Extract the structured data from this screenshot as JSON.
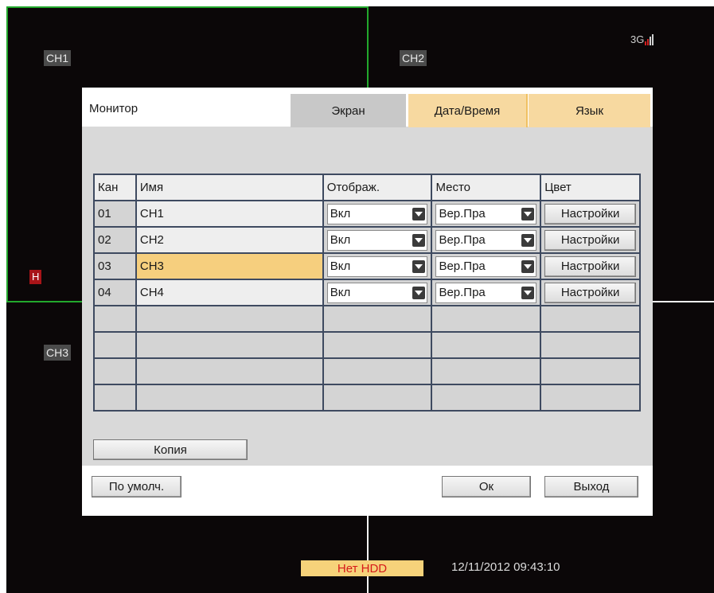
{
  "channels": [
    "CH1",
    "CH2",
    "CH3"
  ],
  "recording_indicator": "H",
  "signal": {
    "label": "3G"
  },
  "dialog": {
    "title": "Монитор",
    "tabs": [
      "Экран",
      "Дата/Время",
      "Язык"
    ],
    "table": {
      "headers": [
        "Кан",
        "Имя",
        "Отображ.",
        "Место",
        "Цвет"
      ],
      "rows": [
        {
          "num": "01",
          "name": "CH1",
          "display": "Вкл",
          "place": "Вер.Пра",
          "color": "Настройки"
        },
        {
          "num": "02",
          "name": "CH2",
          "display": "Вкл",
          "place": "Вер.Пра",
          "color": "Настройки"
        },
        {
          "num": "03",
          "name": "CH3",
          "display": "Вкл",
          "place": "Вер.Пра",
          "color": "Настройки"
        },
        {
          "num": "04",
          "name": "CH4",
          "display": "Вкл",
          "place": "Вер.Пра",
          "color": "Настройки"
        }
      ],
      "selected_row": "03"
    },
    "copy_label": "Копия",
    "default_label": "По умолч.",
    "ok_label": "Ок",
    "exit_label": "Выход"
  },
  "status": {
    "hdd": "Нет HDD",
    "datetime": "12/11/2012 09:43:10"
  },
  "colors": {
    "background": "#0b0708",
    "selection": "#f6cf7e",
    "tab_inactive": "#f7d9a0",
    "tab_active": "#c8c8c8",
    "border_selected": "#22a82c",
    "hdd_bg": "#f6d27a",
    "hdd_text": "#d61a1a"
  }
}
